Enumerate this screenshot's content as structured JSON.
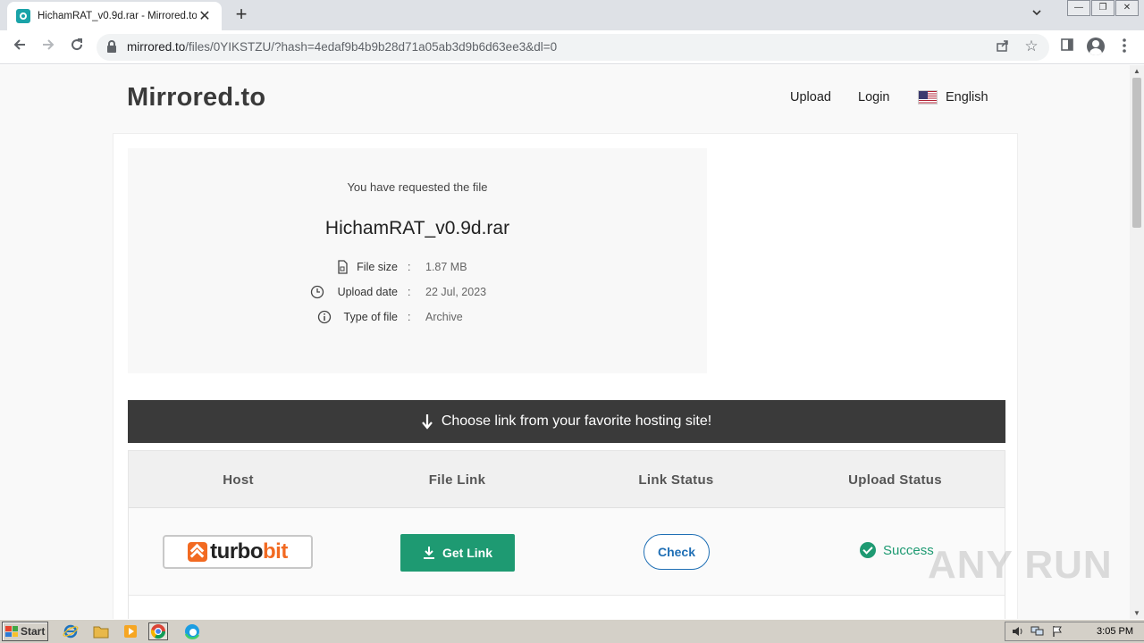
{
  "browser": {
    "tab_title": "HichamRAT_v0.9d.rar - Mirrored.to",
    "tab_close": "✕",
    "new_tab": "+",
    "url_domain": "mirrored.to",
    "url_path": "/files/0YIKSTZU/?hash=4edaf9b4b9b28d71a05ab3d9b6d63ee3&dl=0",
    "window_buttons": [
      "—",
      "❐",
      "✕"
    ]
  },
  "site": {
    "logo": "Mirrored.to",
    "nav": {
      "upload": "Upload",
      "login": "Login",
      "language": "English"
    }
  },
  "file": {
    "requested_text": "You have requested the file",
    "name": "HichamRAT_v0.9d.rar",
    "details": [
      {
        "icon": "file-icon",
        "label": "File size",
        "value": "1.87 MB"
      },
      {
        "icon": "clock-icon",
        "label": "Upload date",
        "value": "22 Jul, 2023"
      },
      {
        "icon": "info-icon",
        "label": "Type of file",
        "value": "Archive"
      }
    ],
    "separator": ":"
  },
  "banner": {
    "text": "Choose link from your favorite hosting site!"
  },
  "table": {
    "headers": [
      "Host",
      "File Link",
      "Link Status",
      "Upload Status"
    ],
    "rows": [
      {
        "host_logo_part1": "turbo",
        "host_logo_part2": "bit",
        "file_link_label": "Get Link",
        "link_status_label": "Check",
        "upload_status": "Success"
      }
    ]
  },
  "watermark": "ANY RUN",
  "taskbar": {
    "start_label": "Start",
    "clock": "3:05 PM"
  },
  "colors": {
    "accent_green": "#1e9a72",
    "check_blue": "#1f6fb5",
    "banner_dark": "#3a3a3a",
    "turbobit_orange": "#f26a21"
  }
}
